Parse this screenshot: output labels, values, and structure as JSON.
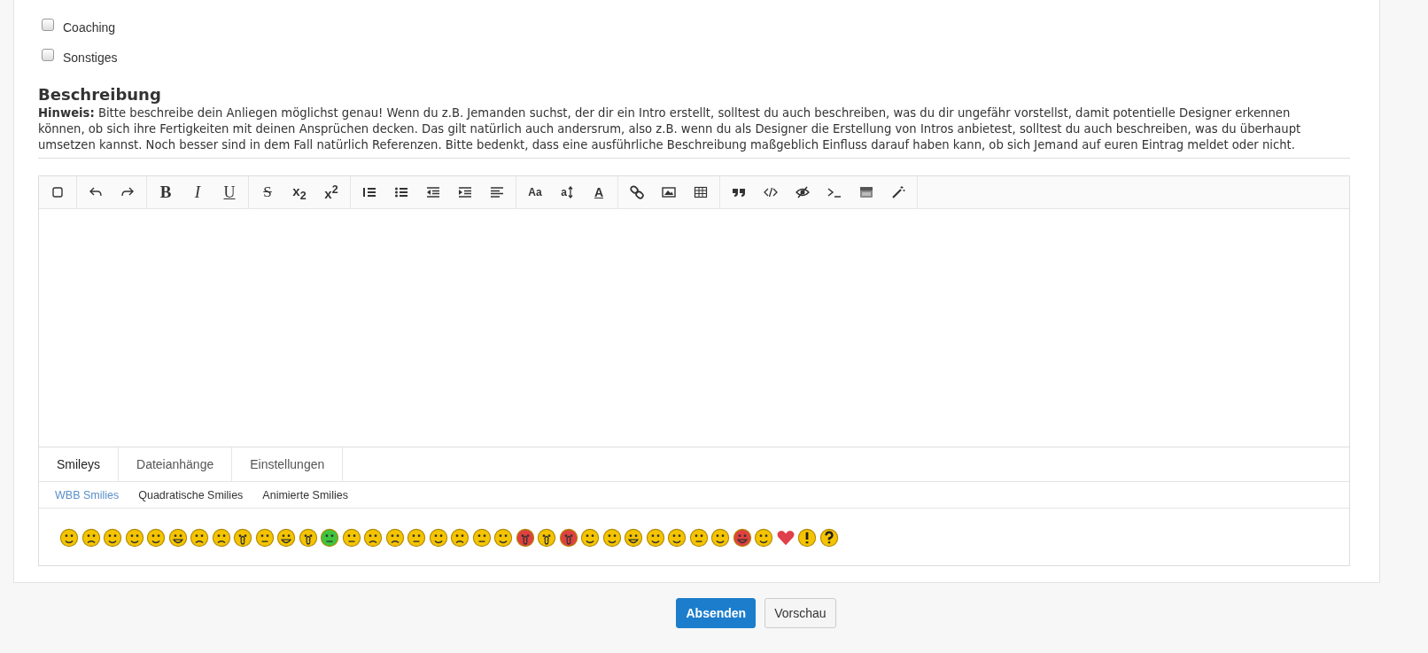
{
  "options": [
    {
      "label": "Coaching",
      "checked": false
    },
    {
      "label": "Sonstiges",
      "checked": false
    }
  ],
  "description": {
    "heading": "Beschreibung",
    "hint_label": "Hinweis:",
    "hint": "Bitte beschreibe dein Anliegen möglichst genau! Wenn du z.B. Jemanden suchst, der dir ein Intro erstellt, solltest du auch beschreiben, was du dir ungefähr vorstellst, damit potentielle Designer erkennen können, ob sich ihre Fertigkeiten mit deinen Ansprüchen decken. Das gilt natürlich auch andersrum, also z.B. wenn du als Designer die Erstellung von Intros anbietest, solltest du auch beschreiben, was du überhaupt umsetzen kannst. Noch besser sind in dem Fall natürlich Referenzen. Bitte bedenkt, dass eine ausführliche Beschreibung maßgeblich Einfluss darauf haben kann, ob sich Jemand auf euren Eintrag meldet oder nicht."
  },
  "toolbar": [
    [
      {
        "kind": "checkbox"
      }
    ],
    [
      {
        "kind": "undo"
      },
      {
        "kind": "redo"
      }
    ],
    [
      {
        "kind": "bold",
        "label": "B"
      },
      {
        "kind": "italic",
        "label": "I"
      },
      {
        "kind": "underline",
        "label": "U"
      }
    ],
    [
      {
        "kind": "strike",
        "label": "S"
      },
      {
        "kind": "rich",
        "label": "x$_{2}$"
      },
      {
        "kind": "rich",
        "label": "x$^{2}$"
      }
    ],
    [
      {
        "kind": "ol"
      },
      {
        "kind": "ul"
      },
      {
        "kind": "outdent"
      },
      {
        "kind": "indent"
      },
      {
        "kind": "align"
      }
    ],
    [
      {
        "kind": "small",
        "label": "Aa"
      },
      {
        "kind": "size",
        "label": "a"
      },
      {
        "kind": "color",
        "label": "A"
      }
    ],
    [
      {
        "kind": "link"
      },
      {
        "kind": "image"
      },
      {
        "kind": "table"
      }
    ],
    [
      {
        "kind": "quote"
      },
      {
        "kind": "code"
      },
      {
        "kind": "hide"
      },
      {
        "kind": "terminal"
      },
      {
        "kind": "media"
      },
      {
        "kind": "wand"
      }
    ]
  ],
  "tabs": [
    {
      "label": "Smileys",
      "selected": true
    },
    {
      "label": "Dateianhänge",
      "selected": false
    },
    {
      "label": "Einstellungen",
      "selected": false
    }
  ],
  "subtabs": [
    {
      "label": "WBB Smilies",
      "selected": true
    },
    {
      "label": "Quadratische Smilies",
      "selected": false
    },
    {
      "label": "Animierte Smilies",
      "selected": false
    }
  ],
  "buttons": [
    {
      "label": "Absenden",
      "kind": "primary"
    },
    {
      "label": "Vorschau",
      "kind": "default"
    }
  ]
}
